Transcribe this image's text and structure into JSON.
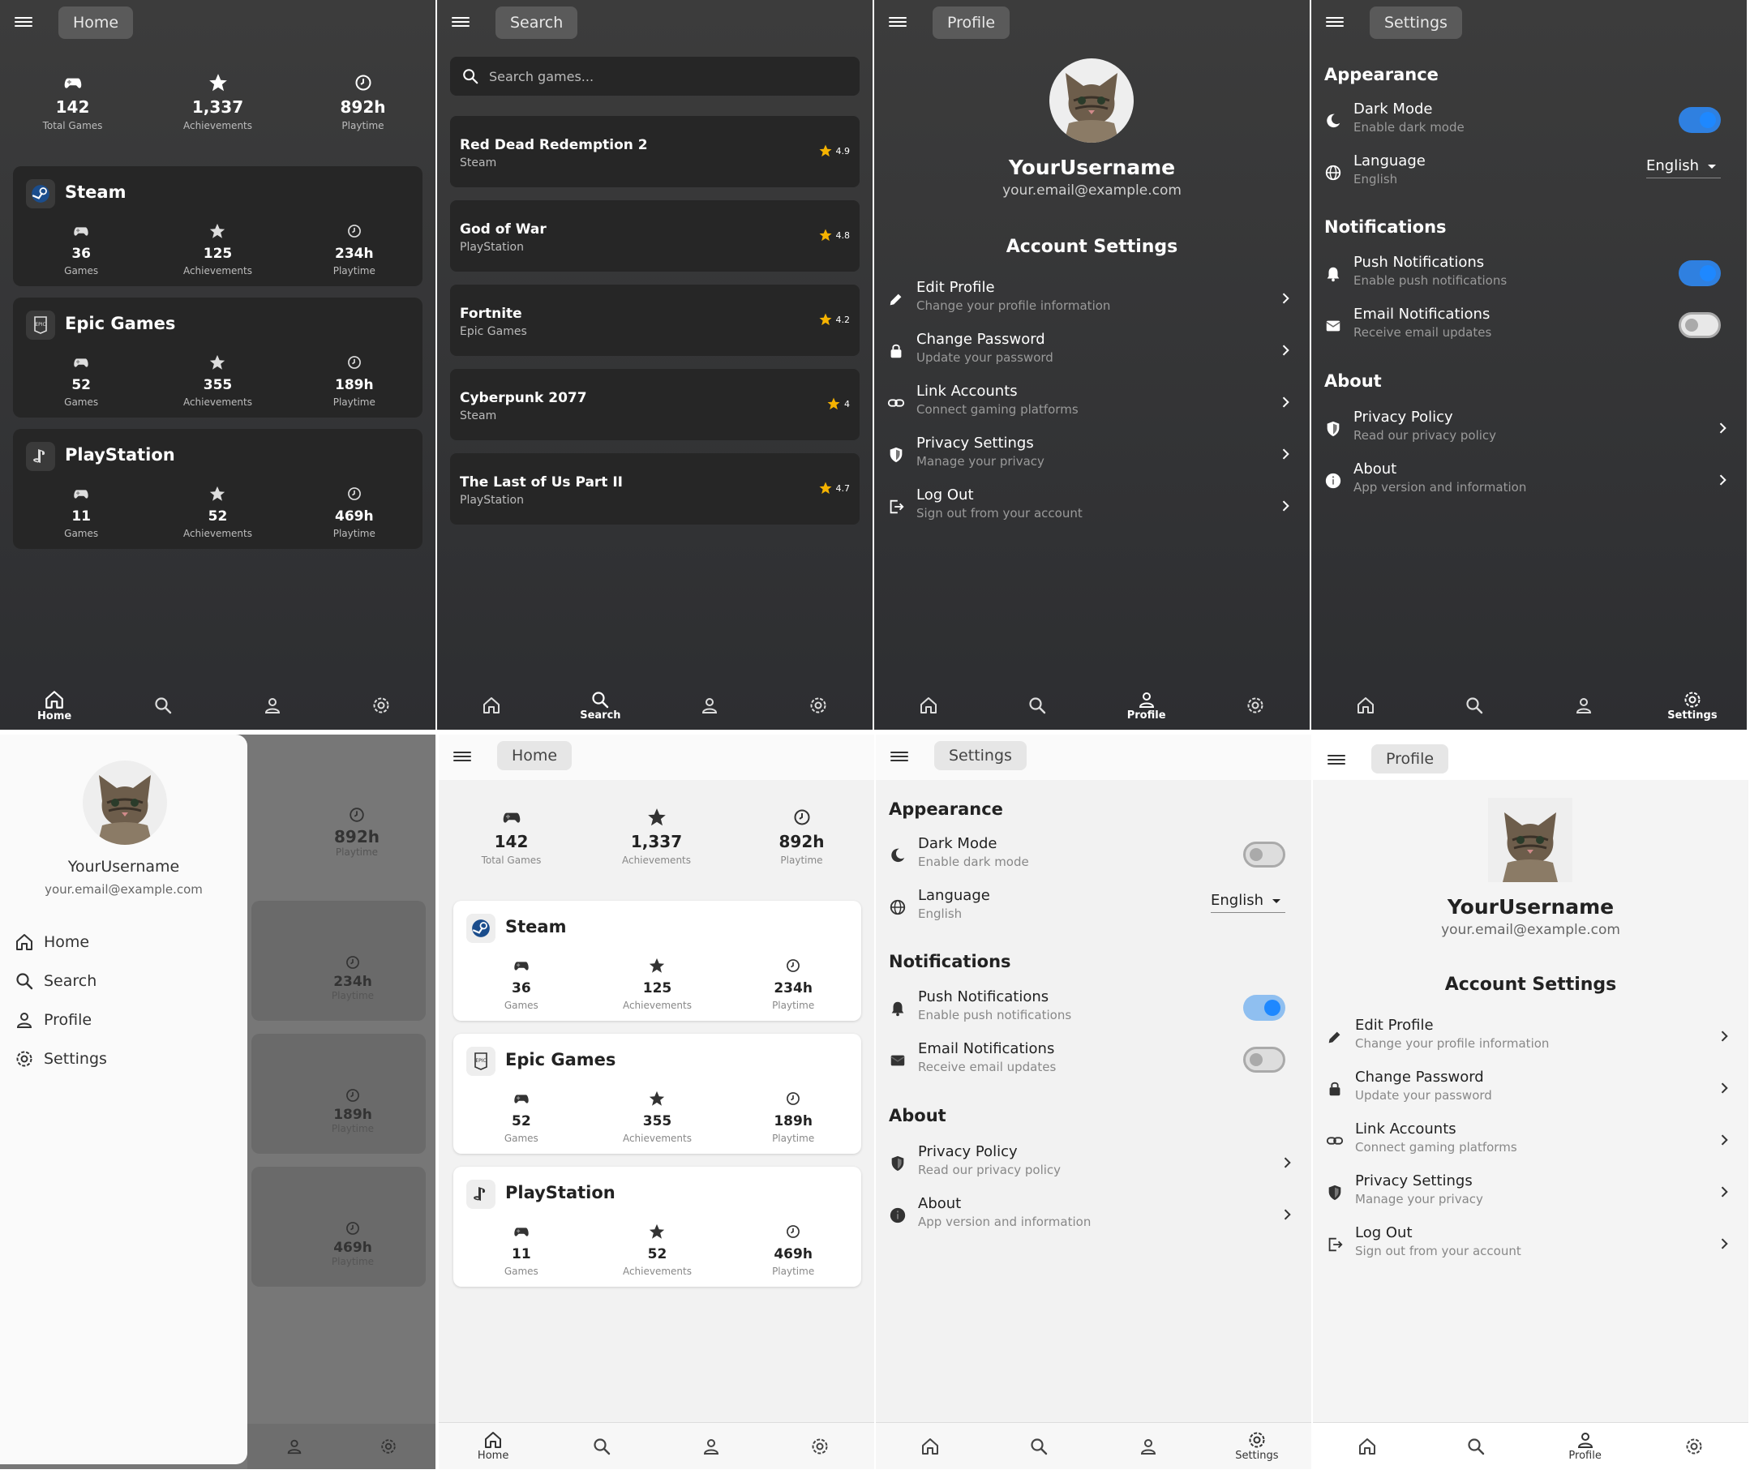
{
  "stats": {
    "total_games": "142",
    "total_games_label": "Total Games",
    "achievements": "1,337",
    "achievements_label": "Achievements",
    "playtime": "892h",
    "playtime_label": "Playtime"
  },
  "platforms": [
    {
      "name": "Steam",
      "games": "36",
      "achievements": "125",
      "playtime": "234h"
    },
    {
      "name": "Epic Games",
      "games": "52",
      "achievements": "355",
      "playtime": "189h"
    },
    {
      "name": "PlayStation",
      "games": "11",
      "achievements": "52",
      "playtime": "469h"
    }
  ],
  "labels": {
    "games": "Games",
    "achievements": "Achievements",
    "playtime": "Playtime"
  },
  "nav": {
    "home": "Home",
    "search": "Search",
    "profile": "Profile",
    "settings": "Settings"
  },
  "search": {
    "placeholder": "Search games...",
    "results": [
      {
        "title": "Red Dead Redemption 2",
        "platform": "Steam",
        "rating": "4.9"
      },
      {
        "title": "God of War",
        "platform": "PlayStation",
        "rating": "4.8"
      },
      {
        "title": "Fortnite",
        "platform": "Epic Games",
        "rating": "4.2"
      },
      {
        "title": "Cyberpunk 2077",
        "platform": "Steam",
        "rating": "4"
      },
      {
        "title": "The Last of Us Part II",
        "platform": "PlayStation",
        "rating": "4.7"
      }
    ]
  },
  "profile": {
    "username": "YourUsername",
    "email": "your.email@example.com",
    "account_settings_title": "Account Settings",
    "items": [
      {
        "title": "Edit Profile",
        "subtitle": "Change your profile information",
        "icon": "pencil-icon"
      },
      {
        "title": "Change Password",
        "subtitle": "Update your password",
        "icon": "lock-icon"
      },
      {
        "title": "Link Accounts",
        "subtitle": "Connect gaming platforms",
        "icon": "link-icon"
      },
      {
        "title": "Privacy Settings",
        "subtitle": "Manage your privacy",
        "icon": "shield-icon"
      },
      {
        "title": "Log Out",
        "subtitle": "Sign out from your account",
        "icon": "logout-icon"
      }
    ]
  },
  "settings": {
    "appearance_title": "Appearance",
    "dark_mode": {
      "title": "Dark Mode",
      "subtitle": "Enable dark mode"
    },
    "language": {
      "title": "Language",
      "subtitle": "English",
      "value": "English"
    },
    "notifications_title": "Notifications",
    "push": {
      "title": "Push Notifications",
      "subtitle": "Enable push notifications"
    },
    "email_notif": {
      "title": "Email Notifications",
      "subtitle": "Receive email updates"
    },
    "about_title": "About",
    "privacy": {
      "title": "Privacy Policy",
      "subtitle": "Read our privacy policy"
    },
    "about": {
      "title": "About",
      "subtitle": "App version and information"
    }
  },
  "colors": {
    "accent": "#1e88ff",
    "star": "#f5b301",
    "dark_bg": "#333333",
    "light_bg": "#f2f2f2"
  }
}
